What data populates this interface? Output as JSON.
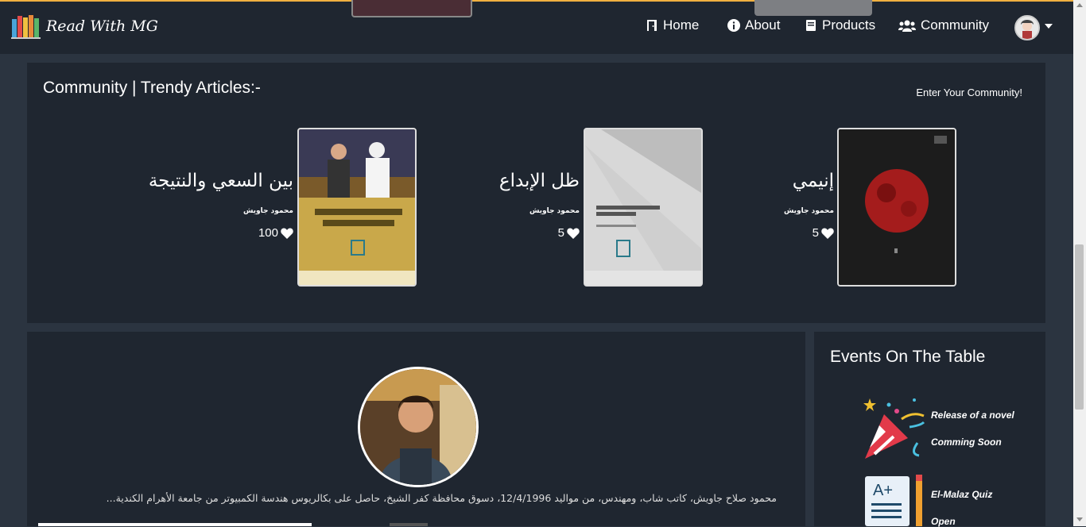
{
  "brand": {
    "name": "Read With MG"
  },
  "nav": {
    "home": "Home",
    "about": "About",
    "products": "Products",
    "community": "Community"
  },
  "community": {
    "title": "Community | Trendy Articles:-",
    "enter_link": "Enter Your Community!",
    "articles": [
      {
        "title": "بين السعي والنتيجة",
        "author": "محمود جاويش",
        "likes": "100"
      },
      {
        "title": "ظل الإبداع",
        "author": "محمود جاويش",
        "likes": "5"
      },
      {
        "title": "إنيمي",
        "author": "محمود جاويش",
        "likes": "5"
      }
    ]
  },
  "profile": {
    "bio": "محمود صلاح جاويش، كاتب شاب، ومهندس، من مواليد 12/4/1996، دسوق محافظة كفر الشيخ، حاصل على بكالريوس هندسة الكمبيوتر من جامعة الأهرام الكندية..."
  },
  "events": {
    "title": "Events On The Table",
    "items": [
      {
        "line1": "Release of a novel",
        "line2": "Comming Soon"
      },
      {
        "line1": "El-Malaz Quiz",
        "line2": "Open"
      }
    ]
  }
}
